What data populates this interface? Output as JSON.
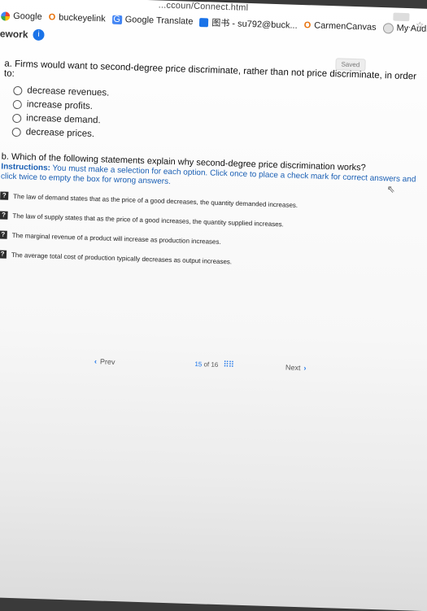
{
  "browser": {
    "url_fragment": "...ccoun/Connect.html",
    "bookmarks": [
      {
        "label": "Google",
        "icon": "google-icon"
      },
      {
        "label": "buckeyelink",
        "icon": "buckeyelink-icon"
      },
      {
        "label": "Google Translate",
        "icon": "translate-icon"
      },
      {
        "label": "图书 - su792@buck...",
        "icon": "account-icon"
      },
      {
        "label": "CarmenCanvas",
        "icon": "canvas-icon"
      },
      {
        "label": "My Audit - u.achiev...",
        "icon": "audit-icon"
      }
    ],
    "toolbar_right": "... ☆"
  },
  "app": {
    "title": "nework",
    "info_badge": "i",
    "saved_label": "Saved"
  },
  "question_a": {
    "prompt": "a. Firms would want to second-degree price discriminate, rather than not price discriminate, in order to:",
    "options": [
      "decrease revenues.",
      "increase profits.",
      "increase demand.",
      "decrease prices."
    ]
  },
  "question_b": {
    "prompt": "b. Which of the following statements explain why second-degree price discrimination works?",
    "instructions_label": "Instructions:",
    "instructions_text": " You must make a selection for each option. Click once to place a check mark for correct answers and click twice to empty the box for wrong answers.",
    "statements": [
      "The law of demand states that as the price of a good decreases, the quantity demanded increases.",
      "The law of supply states that as the price of a good increases, the quantity supplied increases.",
      "The marginal revenue of a product will increase as production increases.",
      "The average total cost of production typically decreases as output increases."
    ],
    "checkbox_symbol": "?"
  },
  "pager": {
    "prev_label": "Prev",
    "current": "15",
    "of_label": "of",
    "total": "16",
    "next_label": "Next"
  }
}
